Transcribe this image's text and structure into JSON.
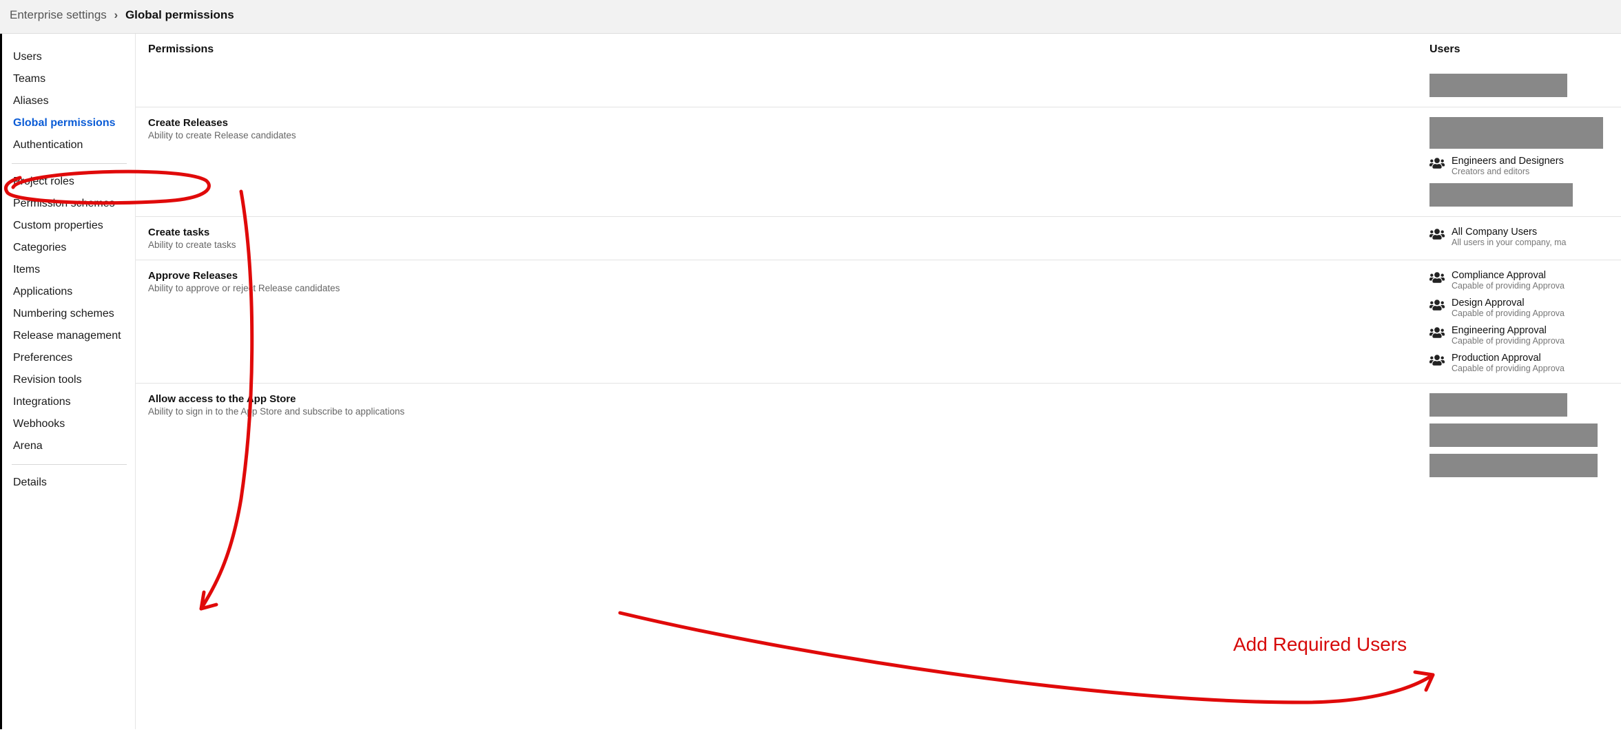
{
  "breadcrumb": {
    "parent": "Enterprise settings",
    "current": "Global permissions"
  },
  "sidebar": {
    "group1": [
      {
        "label": "Users"
      },
      {
        "label": "Teams"
      },
      {
        "label": "Aliases"
      },
      {
        "label": "Global permissions",
        "active": true
      },
      {
        "label": "Authentication"
      }
    ],
    "group2": [
      {
        "label": "Project roles"
      },
      {
        "label": "Permission schemes"
      },
      {
        "label": "Custom properties"
      },
      {
        "label": "Categories"
      },
      {
        "label": "Items"
      },
      {
        "label": "Applications"
      },
      {
        "label": "Numbering schemes"
      },
      {
        "label": "Release management"
      },
      {
        "label": "Preferences"
      },
      {
        "label": "Revision tools"
      },
      {
        "label": "Integrations"
      },
      {
        "label": "Webhooks"
      },
      {
        "label": "Arena"
      }
    ],
    "group3": [
      {
        "label": "Details"
      }
    ]
  },
  "columns": {
    "permissions": "Permissions",
    "users": "Users"
  },
  "permissions": [
    {
      "title": "Create Releases",
      "desc": "Ability to create Release candidates",
      "users": [
        {
          "name": "Engineers and Designers",
          "sub": "Creators and editors"
        }
      ]
    },
    {
      "title": "Create tasks",
      "desc": "Ability to create tasks",
      "users": [
        {
          "name": "All Company Users",
          "sub": "All users in your company, ma"
        }
      ]
    },
    {
      "title": "Approve Releases",
      "desc": "Ability to approve or reject Release candidates",
      "users": [
        {
          "name": "Compliance Approval",
          "sub": "Capable of providing Approva"
        },
        {
          "name": "Design Approval",
          "sub": "Capable of providing Approva"
        },
        {
          "name": "Engineering Approval",
          "sub": "Capable of providing Approva"
        },
        {
          "name": "Production Approval",
          "sub": "Capable of providing Approva"
        }
      ]
    },
    {
      "title": "Allow access to the App Store",
      "desc": "Ability to sign in to the App Store and subscribe to applications",
      "users": []
    }
  ],
  "annotation": {
    "text": "Add Required Users"
  }
}
